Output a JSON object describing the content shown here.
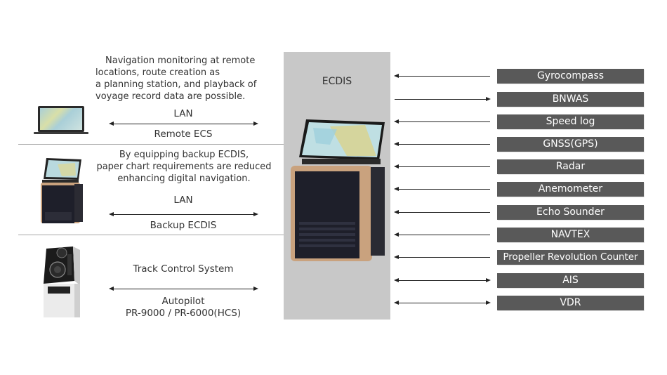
{
  "left_sections": [
    {
      "description_lines": [
        "Navigation monitoring at remote",
        "locations, route creation as",
        "a planning station, and playback of",
        "voyage record data are possible."
      ],
      "link_top_label": "LAN",
      "link_bottom_label": "Remote ECS",
      "device_icon": "laptop-icon"
    },
    {
      "description_lines": [
        "By equipping backup ECDIS,",
        "paper chart requirements are reduced",
        "enhancing digital navigation."
      ],
      "link_top_label": "LAN",
      "link_bottom_label": "Backup ECDIS",
      "device_icon": "backup-ecdis-console-icon"
    },
    {
      "description_lines": [],
      "link_top_label": "Track Control System",
      "link_bottom_label": "Autopilot",
      "link_bottom_label_2": "PR-9000 / PR-6000(HCS)",
      "device_icon": "autopilot-console-icon"
    }
  ],
  "center": {
    "title": "ECDIS",
    "device_icon": "ecdis-console-icon"
  },
  "sensors": [
    {
      "label": "Gyrocompass",
      "direction": "to-ecdis"
    },
    {
      "label": "BNWAS",
      "direction": "from-ecdis"
    },
    {
      "label": "Speed log",
      "direction": "to-ecdis"
    },
    {
      "label": "GNSS(GPS)",
      "direction": "to-ecdis"
    },
    {
      "label": "Radar",
      "direction": "to-ecdis"
    },
    {
      "label": "Anemometer",
      "direction": "to-ecdis"
    },
    {
      "label": "Echo Sounder",
      "direction": "to-ecdis"
    },
    {
      "label": "NAVTEX",
      "direction": "to-ecdis"
    },
    {
      "label": "Propeller Revolution Counter",
      "direction": "to-ecdis"
    },
    {
      "label": "AIS",
      "direction": "bidirectional"
    },
    {
      "label": "VDR",
      "direction": "bidirectional"
    }
  ],
  "colors": {
    "sensor_box": "#595959",
    "center_panel": "#c8c8c8",
    "console_trim": "#c9a27e",
    "console_body": "#1e1f2a"
  }
}
